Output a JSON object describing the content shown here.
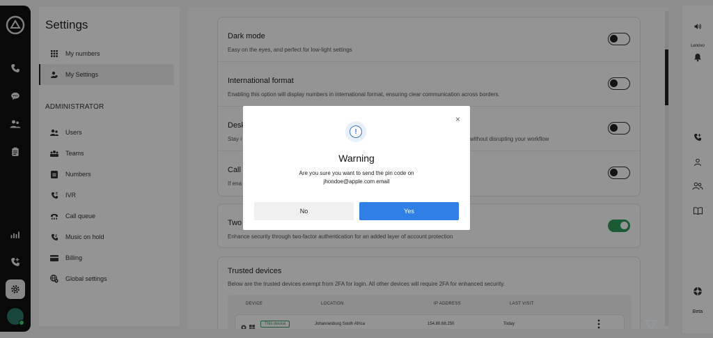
{
  "sidebar": {
    "title": "Settings",
    "items": [
      {
        "label": "My numbers",
        "icon": "grid-icon"
      },
      {
        "label": "My Settings",
        "icon": "user-icon"
      }
    ],
    "admin_heading": "ADMINISTRATOR",
    "admin_items": [
      {
        "label": "Users",
        "icon": "users-icon"
      },
      {
        "label": "Teams",
        "icon": "teams-icon"
      },
      {
        "label": "Numbers",
        "icon": "numbers-icon"
      },
      {
        "label": "IVR",
        "icon": "ivr-icon"
      },
      {
        "label": "Call queue",
        "icon": "call-queue-icon"
      },
      {
        "label": "Music on hold",
        "icon": "music-on-hold-icon"
      },
      {
        "label": "Billing",
        "icon": "billing-icon"
      },
      {
        "label": "Global settings",
        "icon": "global-settings-icon"
      }
    ]
  },
  "settings": [
    {
      "title": "Dark mode",
      "desc": "Easy on the eyes, and perfect for low-light settings",
      "on": false
    },
    {
      "title": "International format",
      "desc": "Enabling this option will display numbers in international format, ensuring clear communication across borders.",
      "on": false
    },
    {
      "title": "Desk",
      "desc": "Stay i",
      "desc_tail": "without disrupting your workflow",
      "on": false
    },
    {
      "title": "Call",
      "desc": "If ena",
      "on": false
    }
  ],
  "twofa": {
    "title": "Two",
    "desc": "Enhance security through two-factor authentication for an added layer of account protection",
    "on": true
  },
  "trusted": {
    "title": "Trusted devices",
    "desc": "Below are the trusted devices exempt from 2FA for login. All other devices will require 2FA for enhanced security.",
    "columns": [
      "DEVICE",
      "LOCATION",
      "IP ADDRESS",
      "LAST VISIT"
    ],
    "rows": [
      {
        "badge": "This device",
        "location": "Johannesburg South Africa",
        "ip": "154.80.68.250",
        "last": "Today"
      }
    ]
  },
  "right_panel": {
    "device_label": "Lenovo",
    "beta_label": "Beta"
  },
  "modal": {
    "title": "Warning",
    "line1": "Are you sure you want to send the pin code on",
    "line2": "jhondoe@apple.com email",
    "no_label": "No",
    "yes_label": "Yes",
    "close_glyph": "×",
    "icon_glyph": "!"
  },
  "colors": {
    "accent": "#2f7fe6",
    "toggle_on": "#2d9b5a",
    "rail": "#111111"
  }
}
